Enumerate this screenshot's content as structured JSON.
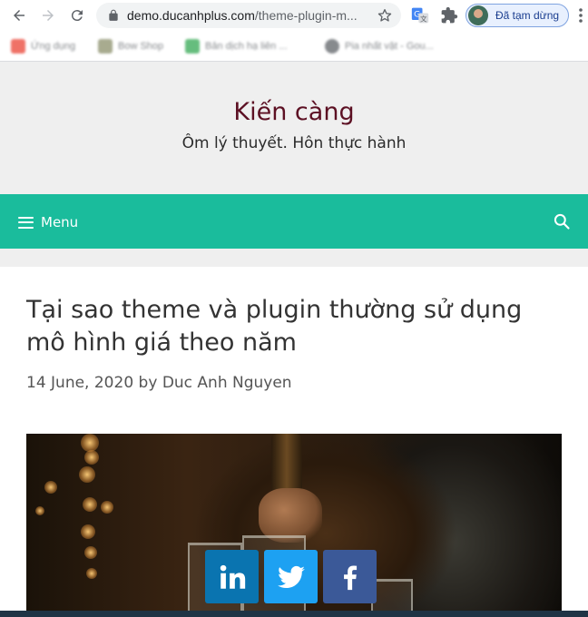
{
  "browser": {
    "url_host": "demo.ducanhplus.com",
    "url_path": "/theme-plugin-m...",
    "profile_label": "Đã tạm dừng",
    "bookmarks": [
      {
        "label": "Ứng dụng",
        "color": "#ea4335"
      },
      {
        "label": "Bow Shop",
        "color": "#8b8f6a"
      },
      {
        "label": "Bản dịch hạ liên ...",
        "color": "#34a853"
      },
      {
        "label": "Pia nhất vật - Gou...",
        "color": "#5f6368"
      }
    ],
    "icons": [
      "back-arrow-icon",
      "forward-arrow-icon",
      "reload-icon",
      "lock-icon",
      "star-icon",
      "translate-icon",
      "puzzle-icon",
      "kebab-menu-icon"
    ]
  },
  "site": {
    "title": "Kiến càng",
    "tagline": "Ôm lý thuyết. Hôn thực hành",
    "title_color": "#5c1023",
    "accent": "#1abc9c"
  },
  "nav": {
    "menu_label": "Menu",
    "search_icon": "search-icon"
  },
  "post": {
    "title": "Tại sao theme và plugin thường sử dụng mô hình giá theo năm",
    "date": "14 June, 2020",
    "by": "by",
    "author": "Duc Anh Nguyen"
  },
  "share": [
    {
      "network": "linkedin",
      "icon": "linkedin-icon",
      "color": "#0a74b0"
    },
    {
      "network": "twitter",
      "icon": "twitter-icon",
      "color": "#1da1f2"
    },
    {
      "network": "facebook",
      "icon": "facebook-icon",
      "color": "#3b5998"
    }
  ]
}
